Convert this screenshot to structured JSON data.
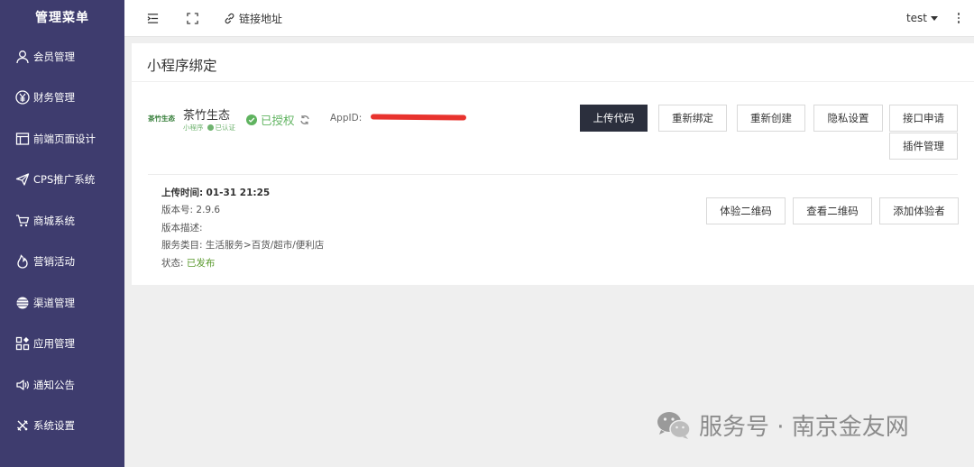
{
  "sidebar": {
    "title": "管理菜单",
    "items": [
      {
        "label": "会员管理",
        "icon": "user-icon"
      },
      {
        "label": "财务管理",
        "icon": "yen-icon"
      },
      {
        "label": "前端页面设计",
        "icon": "layout-icon"
      },
      {
        "label": "CPS推广系统",
        "icon": "send-icon"
      },
      {
        "label": "商城系统",
        "icon": "cart-icon"
      },
      {
        "label": "营销活动",
        "icon": "fire-icon"
      },
      {
        "label": "渠道管理",
        "icon": "globe-icon"
      },
      {
        "label": "应用管理",
        "icon": "apps-icon"
      },
      {
        "label": "通知公告",
        "icon": "speaker-icon"
      },
      {
        "label": "系统设置",
        "icon": "tools-icon"
      }
    ],
    "bg_color": "#3e3c6e"
  },
  "header": {
    "link_label": "链接地址",
    "user": "test"
  },
  "card": {
    "title": "小程序绑定",
    "brand_logo_text": "茶竹生态",
    "app_name": "茶竹生态",
    "app_type": "小程序",
    "verified": "已认证",
    "auth_status": "已授权",
    "appid_label": "AppID:",
    "buttons": {
      "upload": "上传代码",
      "rebind": "重新绑定",
      "recreate": "重新创建",
      "privacy": "隐私设置",
      "api_apply": "接口申请",
      "plugins": "插件管理",
      "trial_qr": "体验二维码",
      "view_qr": "查看二维码",
      "add_tester": "添加体验者"
    },
    "info": {
      "upload_time_label": "上传时间:",
      "upload_time": "01-31 21:25",
      "version_label": "版本号:",
      "version": "2.9.6",
      "desc_label": "版本描述:",
      "desc": "",
      "category_label": "服务类目:",
      "category": "生活服务>百货/超市/便利店",
      "status_label": "状态:",
      "status": "已发布"
    }
  },
  "watermark": "服务号 · 南京金友网",
  "colors": {
    "primary_button": "#2b2f3d",
    "success": "#5fb35f",
    "redaction": "#e8332e"
  }
}
